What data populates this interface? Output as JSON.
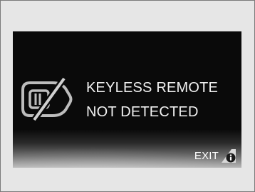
{
  "display": {
    "message_line_1": "KEYLESS REMOTE",
    "message_line_2": "NOT DETECTED",
    "exit_label": "EXIT",
    "icon": "keyless-remote-not-detected-icon",
    "info_icon": "info-icon"
  },
  "colors": {
    "screen_background": "#0a0a0a",
    "text": "#f2f2f2",
    "icon": "#bdbdbd",
    "page_background": "#e6e6e6"
  }
}
